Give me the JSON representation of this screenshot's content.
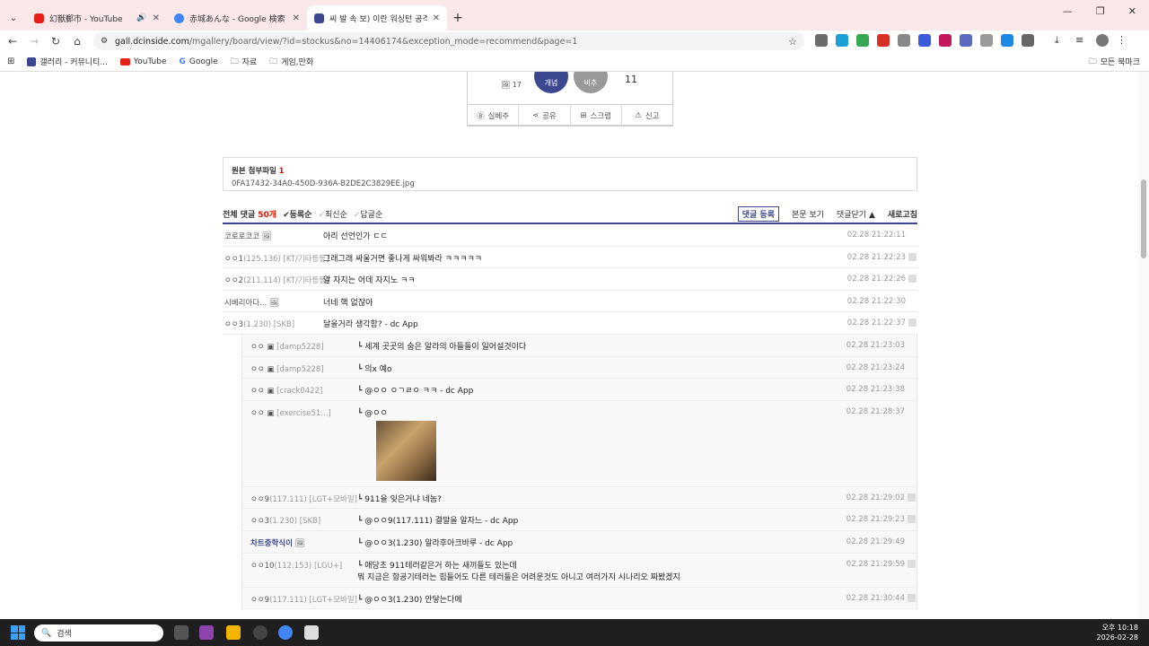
{
  "tabs": [
    {
      "title": "幻獣郵市 - YouTube",
      "fav": "#e62117"
    },
    {
      "title": "赤城あんな - Google 検索",
      "fav": "#4285f4"
    },
    {
      "title": "씨 발 속 보) 이란 워싱턴 공격",
      "fav": "#3b4890"
    }
  ],
  "url_host": "gall.dcinside.com",
  "url_rest": "/mgallery/board/view/?id=stockus&no=14406174&exception_mode=recommend&page=1",
  "bookmarks": [
    "갤러리 - 커뮤니티...",
    "YouTube",
    "Google",
    "자료",
    "게임,만화"
  ],
  "bookmarks_all": "모든 북마크",
  "vote": {
    "up_label": "개념",
    "down_label": "비추",
    "up_small": "17",
    "down_count": "11"
  },
  "actions": [
    "실베추",
    "공유",
    "스크랩",
    "신고"
  ],
  "attach_title": "원본 첨부파일",
  "attach_count": "1",
  "attach_file": "0FA17432-34A0-450D-936A-B2DE2C3829EE.jpg",
  "cmt": {
    "total": "전체 댓글",
    "count": "50개",
    "sort1": "등록순",
    "sort2": "최신순",
    "sort3": "답글순",
    "register": "댓글 등록",
    "view_body": "본문 보기",
    "close": "댓글닫기 ▲",
    "refresh": "새로고침"
  },
  "comments": [
    {
      "nick": "코로로코코",
      "ip": "",
      "text": "아리 선언인가 ㄷㄷ",
      "date": "02.28 21:22:11",
      "reply": false
    },
    {
      "nick": "ㅇㅇ1",
      "ip": "(125.136) [KT/기타등등]",
      "text": "그래그래 싸울거면 좋나게 싸워봐라 ㅋㅋㅋㅋㅋ",
      "date": "02.28 21:22:23",
      "reply": false
    },
    {
      "nick": "ㅇㅇ2",
      "ip": "(211.114) [KT/기타등등]",
      "text": "알 자지는 어데 자지노 ㅋㅋ",
      "date": "02.28 21:22:26",
      "reply": false
    },
    {
      "nick": "시베리아다...",
      "ip": "",
      "text": "너네 핵 없잖아",
      "date": "02.28 21:22:30",
      "reply": false
    },
    {
      "nick": "ㅇㅇ3",
      "ip": "(1.230) [SKB]",
      "text": "달을거라 생각함? - dc App",
      "date": "02.28 21:22:37",
      "reply": false
    },
    {
      "nick": "ㅇㅇ",
      "ip": "[damp5228]",
      "text": "세계 곳곳의 숨은 알라의 아들들이 일어설것이다",
      "date": "02.28 21:23:03",
      "reply": true
    },
    {
      "nick": "ㅇㅇ",
      "ip": "[damp5228]",
      "text": "의x 예o",
      "date": "02.28 21:23:24",
      "reply": true
    },
    {
      "nick": "ㅇㅇ",
      "ip": "[crack0422]",
      "text": "@ㅇㅇ ㅇㄱㄹㅇ ㅋㅋ - dc App",
      "date": "02.28 21:23:38",
      "reply": true
    },
    {
      "nick": "ㅇㅇ",
      "ip": "[exercise51...]",
      "text": "@ㅇㅇ",
      "date": "02.28 21:28:37",
      "reply": true,
      "img": true
    },
    {
      "nick": "ㅇㅇ9",
      "ip": "(117.111) [LGT+모바일]",
      "text": "911을 잊은거냐 네놈?",
      "date": "02.28 21:29:02",
      "reply": true
    },
    {
      "nick": "ㅇㅇ3",
      "ip": "(1.230) [SKB]",
      "text": "@ㅇㅇ9(117.111) 결말을 알자느 - dc App",
      "date": "02.28 21:29:23",
      "reply": true
    },
    {
      "nick": "차트중학식이",
      "ip": "",
      "text": "@ㅇㅇ3(1.230) 알라후아크바루 - dc App",
      "date": "02.28 21:29:49",
      "reply": true
    },
    {
      "nick": "ㅇㅇ10",
      "ip": "(112.153) [LGU+]",
      "text": "애당초 911테러같은거 하는 새끼들도 있는데",
      "text2": "뭐 지금은 항공기테러는 힘들어도 다른 테러들은 어려운것도 아니고 여러가지 시나리오 짜봤겠지",
      "date": "02.28 21:29:59",
      "reply": true
    },
    {
      "nick": "ㅇㅇ9",
      "ip": "(117.111) [LGT+모바일]",
      "text": "@ㅇㅇ3(1.230) 안닿는다메",
      "date": "02.28 21:30:44",
      "reply": true
    }
  ],
  "taskbar": {
    "search": "검색",
    "time": "오후 10:18",
    "date": "2026-02-28"
  }
}
